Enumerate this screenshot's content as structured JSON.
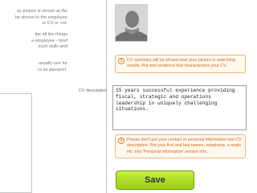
{
  "left_column": {
    "text_blocks": [
      "ay picture is shown at the\nbe shown to the employee\nor CV or not.",
      "ibe all the things\ne employee - brief\nsuch skills and",
      "usually use for\ncs as passport."
    ]
  },
  "photo": {
    "icon": "person-silhouette-icon"
  },
  "summary_notice": {
    "icon": "info-icon",
    "text": "CV summary will be shown near your picture in searching results. Put one sentence that characterizes your CV."
  },
  "cv_description": {
    "label": "CV description",
    "value": "15 years successful experience providing fiscal, strategic and operations leadership in uniquely challenging situations."
  },
  "contact_notice": {
    "icon": "info-icon",
    "text": "Please don't put your contact or personal information into CV description. Put your first and last names, telephone, e-mails etc. into 'Personal information' section info."
  },
  "save_button": {
    "label": "Save"
  },
  "colors": {
    "notice_border": "#f1b57a",
    "notice_text": "#d06a18",
    "save_green": "#98cf14"
  }
}
